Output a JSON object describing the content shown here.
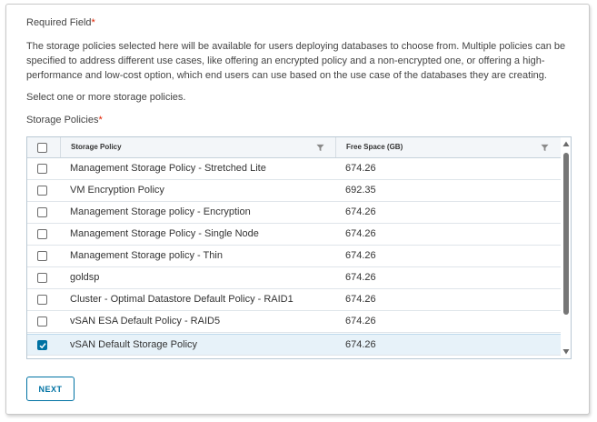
{
  "form": {
    "required_label": "Required Field",
    "required_marker": "*",
    "description": "The storage policies selected here will be available for users deploying databases to choose from. Multiple policies can be specified to address different use cases, like offering an encrypted policy and a non-encrypted one, or offering a high-performance and low-cost option, which end users can use based on the use case of the databases they are creating.",
    "instruction": "Select one or more storage policies.",
    "policies_label": "Storage Policies",
    "policies_marker": "*"
  },
  "grid": {
    "columns": [
      {
        "label": "Storage Policy",
        "filter_icon": "filter-icon"
      },
      {
        "label": "Free Space (GB)",
        "filter_icon": "filter-icon"
      }
    ],
    "rows": [
      {
        "policy": "Management Storage Policy - Stretched Lite",
        "free_space": "674.26",
        "checked": false
      },
      {
        "policy": "VM Encryption Policy",
        "free_space": "692.35",
        "checked": false
      },
      {
        "policy": "Management Storage policy - Encryption",
        "free_space": "674.26",
        "checked": false
      },
      {
        "policy": "Management Storage Policy - Single Node",
        "free_space": "674.26",
        "checked": false
      },
      {
        "policy": "Management Storage policy - Thin",
        "free_space": "674.26",
        "checked": false
      },
      {
        "policy": "goldsp",
        "free_space": "674.26",
        "checked": false
      },
      {
        "policy": "Cluster - Optimal Datastore Default Policy - RAID1",
        "free_space": "674.26",
        "checked": false
      },
      {
        "policy": "vSAN ESA Default Policy - RAID5",
        "free_space": "674.26",
        "checked": false
      },
      {
        "policy": "vSAN Default Storage Policy",
        "free_space": "674.26",
        "checked": true
      }
    ]
  },
  "actions": {
    "next_label": "NEXT"
  },
  "colors": {
    "accent": "#0072a3",
    "required": "#e12200",
    "selected_row": "#e7f2f9",
    "header_bg": "#f3f6f9"
  }
}
